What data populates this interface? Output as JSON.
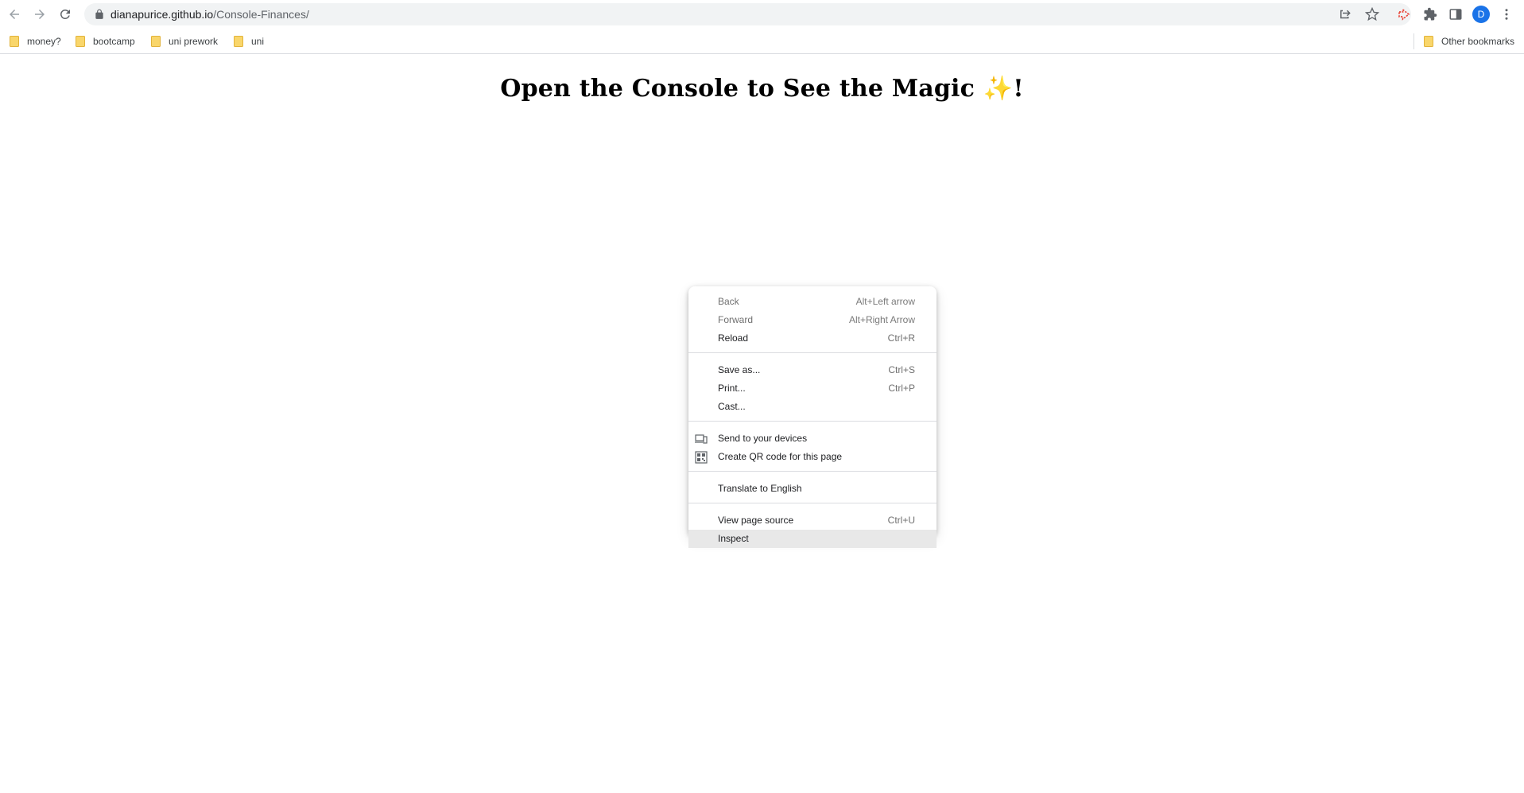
{
  "browser": {
    "url_host": "dianapurice.github.io",
    "url_path": "/Console-Finances/",
    "profile_initial": "D"
  },
  "bookmarks": [
    {
      "label": "money?"
    },
    {
      "label": "bootcamp"
    },
    {
      "label": "uni prework"
    },
    {
      "label": "uni"
    }
  ],
  "other_bookmarks": "Other bookmarks",
  "page": {
    "heading_text": "Open the Console to See the Magic ",
    "heading_emoji": "✨",
    "heading_end": "!"
  },
  "context_menu": {
    "items": [
      {
        "label": "Back",
        "shortcut": "Alt+Left arrow",
        "disabled": true
      },
      {
        "label": "Forward",
        "shortcut": "Alt+Right Arrow",
        "disabled": true
      },
      {
        "label": "Reload",
        "shortcut": "Ctrl+R"
      },
      {
        "label": "Save as...",
        "shortcut": "Ctrl+S"
      },
      {
        "label": "Print...",
        "shortcut": "Ctrl+P"
      },
      {
        "label": "Cast..."
      },
      {
        "label": "Send to your devices",
        "icon": "send-to-devices-icon"
      },
      {
        "label": "Create QR code for this page",
        "icon": "qr-code-icon"
      },
      {
        "label": "Translate to English"
      },
      {
        "label": "View page source",
        "shortcut": "Ctrl+U"
      },
      {
        "label": "Inspect",
        "highlighted": true
      }
    ]
  },
  "colors": {
    "avatar": "#1a73e8",
    "folder": "#f9d66b",
    "highlight": "#e8e8e8"
  }
}
